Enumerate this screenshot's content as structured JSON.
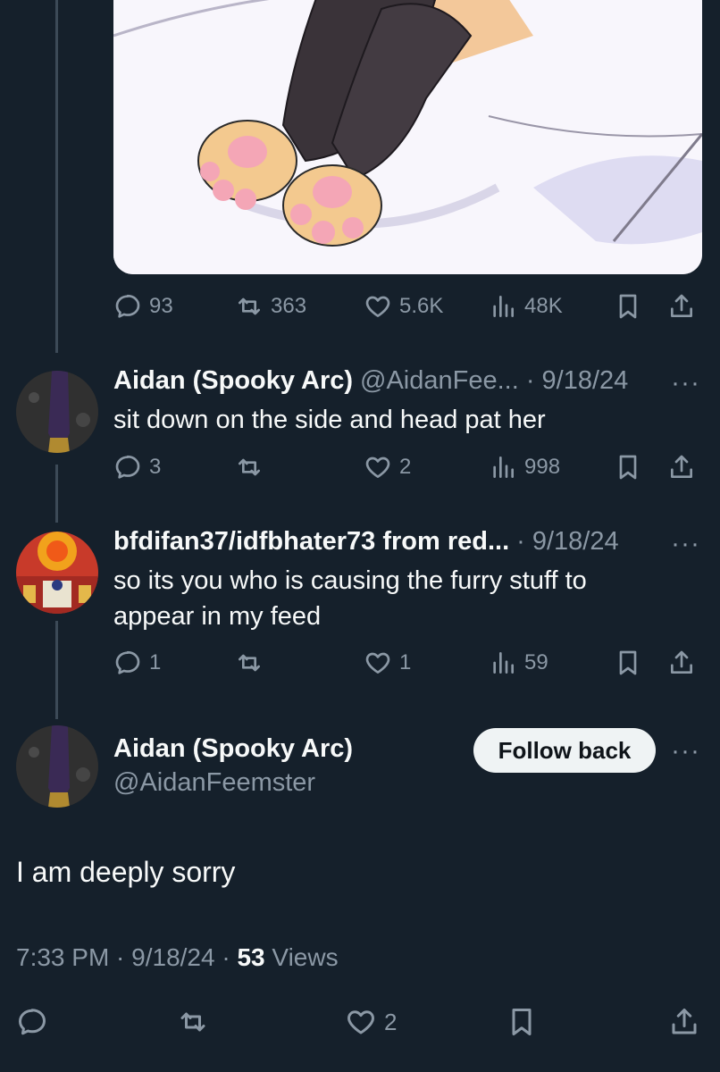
{
  "top_post": {
    "stats": {
      "replies": "93",
      "reposts": "363",
      "likes": "5.6K",
      "views": "48K"
    }
  },
  "replies": [
    {
      "name": "Aidan (Spooky Arc)",
      "meta": "@AidanFee... · 9/18/24",
      "text": "sit down on the side and head pat her",
      "stats": {
        "replies": "3",
        "reposts": "",
        "likes": "2",
        "views": "998"
      }
    },
    {
      "name": "bfdifan37/idfbhater73 from red...",
      "meta": "· 9/18/24",
      "text_line1": "so its you who is causing the furry stuff to",
      "text_line2": "appear in my feed",
      "stats": {
        "replies": "1",
        "reposts": "",
        "likes": "1",
        "views": "59"
      }
    }
  ],
  "focused_post": {
    "name": "Aidan (Spooky Arc)",
    "handle": "@AidanFeemster",
    "follow_label": "Follow back",
    "text": "I am deeply sorry",
    "timestamp": "7:33 PM · 9/18/24 · ",
    "view_count": "53",
    "views_label": " Views",
    "stats": {
      "likes": "2"
    }
  },
  "more_label": "···",
  "colors": {
    "background": "#15202b",
    "muted": "#8b98a5",
    "text": "#f7f9f9",
    "button": "#eff3f4"
  }
}
